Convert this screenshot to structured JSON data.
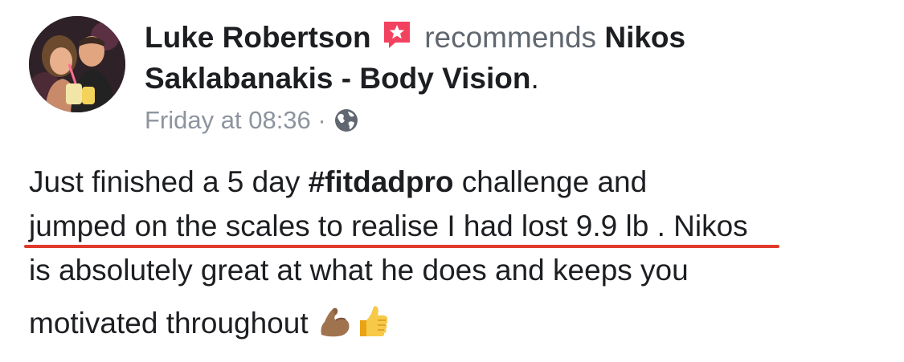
{
  "post": {
    "author": "Luke Robertson",
    "action": "recommends",
    "page_name_line1": "Nikos",
    "page_name_line2": "Saklabanakis - Body Vision",
    "period": ".",
    "timestamp": "Friday at 08:36",
    "separator": "·",
    "privacy_icon": "globe-icon",
    "recommend_icon": "recommendation-star-icon",
    "body": {
      "line1_pre": "Just finished a 5 day ",
      "hashtag": "#fitdadpro",
      "line1_post": " challenge and",
      "line2_highlight": "jumped on the scales to realise I had lost 9.9 lb .",
      "line2_rest": " Nikos",
      "line3": "is absolutely great at what he does and keeps you",
      "line4": "motivated throughout",
      "emoji": [
        "flexed-biceps-icon",
        "thumbs-up-icon"
      ]
    }
  },
  "colors": {
    "text": "#1c1e21",
    "secondary_text": "#606770",
    "meta_text": "#8d949e",
    "recommend_badge": "#f3425f",
    "underline": "#e03a2c"
  }
}
